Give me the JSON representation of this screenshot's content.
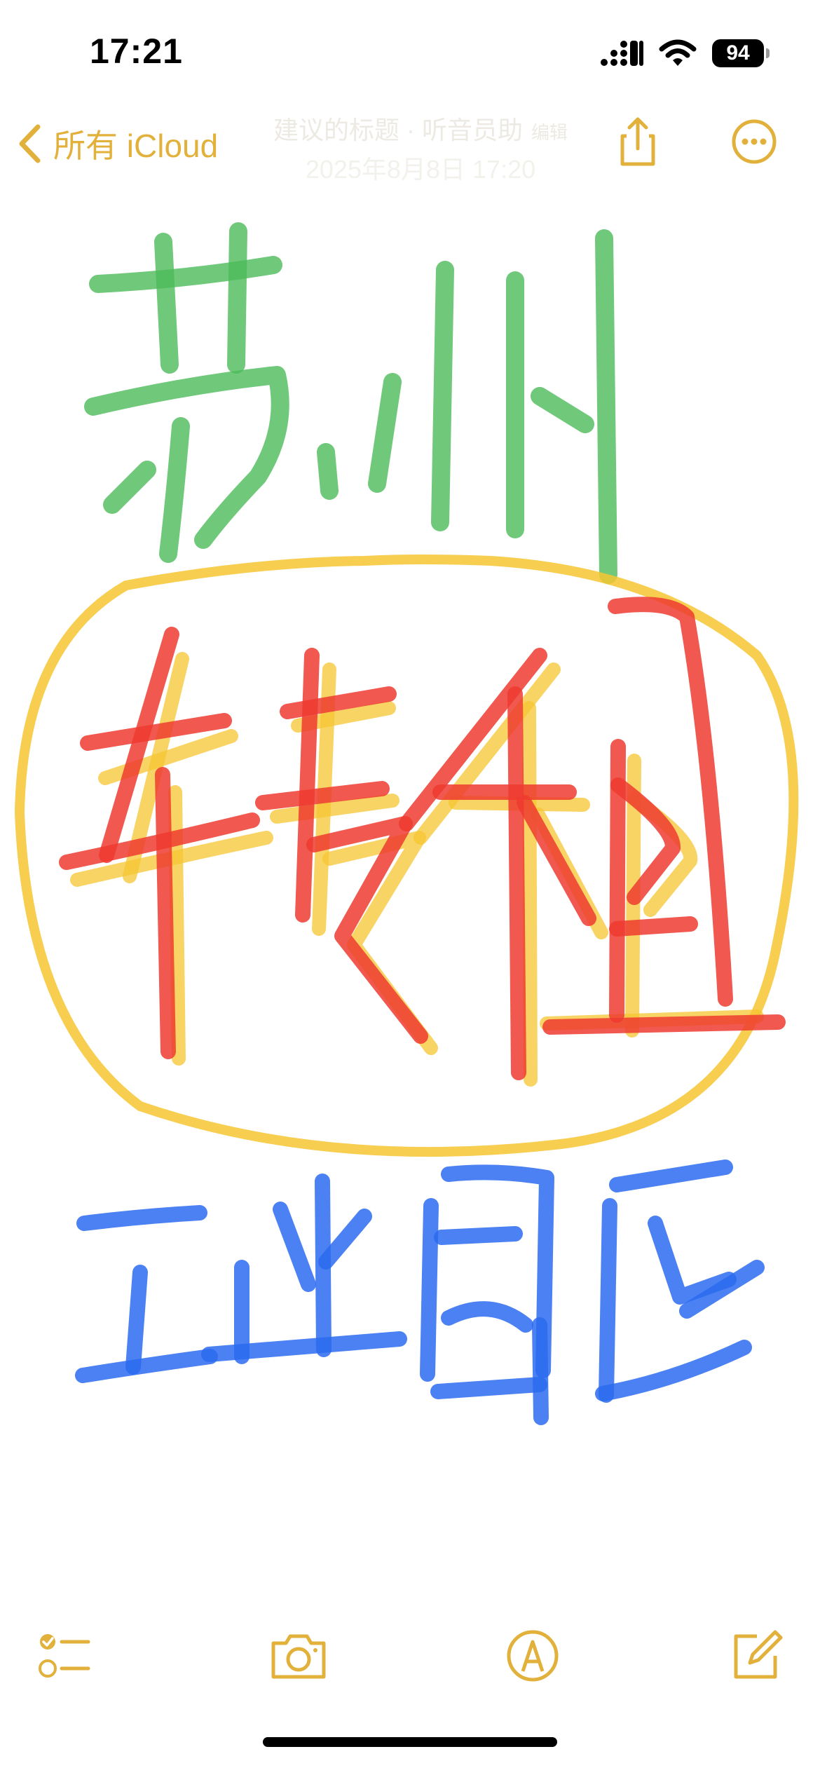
{
  "status_bar": {
    "time": "17:21",
    "battery": "94"
  },
  "nav": {
    "back_label": "所有 iCloud",
    "faded_title": "建议的标题 · 听音员助",
    "faded_badge": "编辑",
    "faded_date": "2025年8月8日 17:20",
    "accent_color": "#E2B13C"
  },
  "drawing": {
    "description_icons": [
      "handwriting-green",
      "handwriting-red",
      "handwriting-yellow",
      "handwriting-blue"
    ],
    "ink_colors": {
      "green": "#4CBB5A",
      "red": "#EE3B30",
      "yellow": "#F6C531",
      "blue": "#2B6BF0"
    }
  },
  "toolbar": {
    "icons": [
      "checklist-icon",
      "camera-icon",
      "markup-icon",
      "compose-icon"
    ]
  }
}
